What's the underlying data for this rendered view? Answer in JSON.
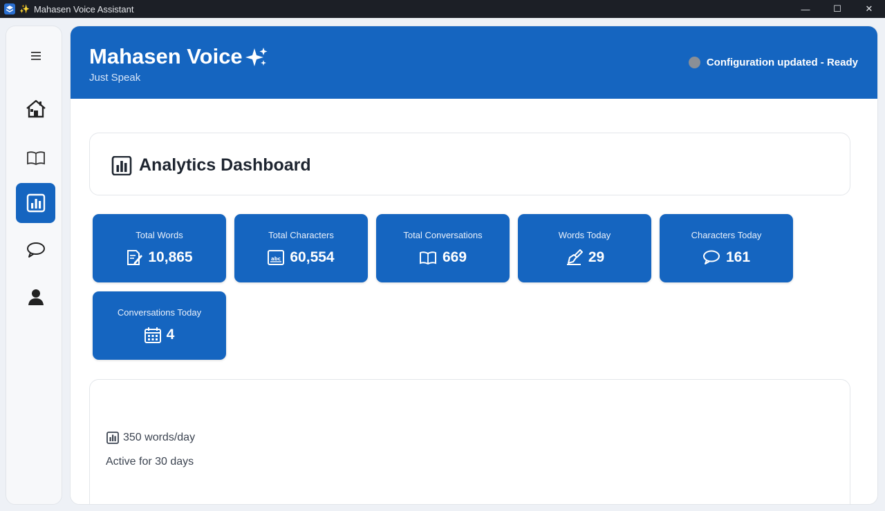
{
  "window": {
    "title": "Mahasen Voice Assistant",
    "controls": {
      "minimize": "—",
      "maximize": "☐",
      "close": "✕"
    }
  },
  "sidebar": {
    "items": [
      {
        "name": "menu",
        "icon": "hamburger-icon"
      },
      {
        "name": "home",
        "icon": "home-icon"
      },
      {
        "name": "dictionary",
        "icon": "book-icon"
      },
      {
        "name": "analytics",
        "icon": "bar-chart-icon",
        "active": true
      },
      {
        "name": "conversations",
        "icon": "chat-bubble-icon"
      },
      {
        "name": "profile",
        "icon": "user-icon"
      }
    ]
  },
  "header": {
    "app_name": "Mahasen Voice",
    "tagline": "Just Speak",
    "status": "Configuration updated - Ready",
    "status_color": "#8a8f96"
  },
  "dashboard": {
    "title": "Analytics Dashboard"
  },
  "stats": [
    {
      "label": "Total Words",
      "value": "10,865",
      "icon": "document-edit-icon"
    },
    {
      "label": "Total Characters",
      "value": "60,554",
      "icon": "abc-icon"
    },
    {
      "label": "Total Conversations",
      "value": "669",
      "icon": "book-icon"
    },
    {
      "label": "Words Today",
      "value": "29",
      "icon": "writing-hand-icon"
    },
    {
      "label": "Characters Today",
      "value": "161",
      "icon": "chat-bubble-icon"
    },
    {
      "label": "Conversations Today",
      "value": "4",
      "icon": "calendar-icon"
    }
  ],
  "summary": {
    "rate": "350 words/day",
    "active": "Active for 30 days"
  },
  "colors": {
    "accent": "#1565c0",
    "titlebar": "#1c1f26",
    "background": "#eef1f6"
  }
}
